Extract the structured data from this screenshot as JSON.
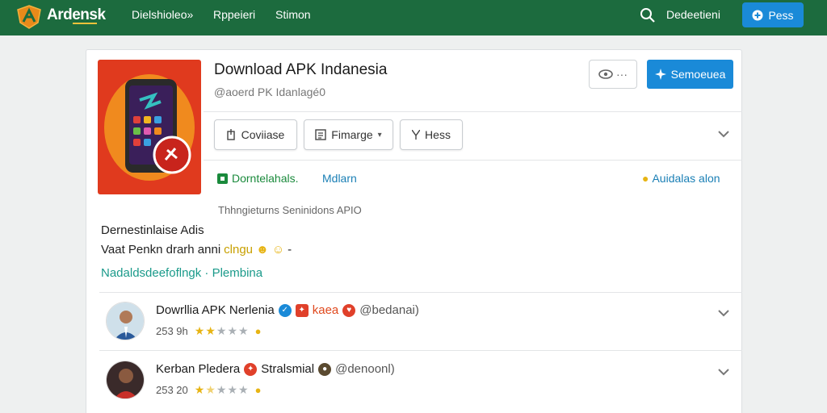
{
  "topbar": {
    "brand": "Ardensk",
    "nav": [
      "Dielshioleo»",
      "Rppeieri",
      "Stimon"
    ],
    "user_label": "Dedeetieni",
    "action_button": "Pess",
    "icons": {
      "logo": "shield-logo-icon",
      "search": "search-icon",
      "action": "plus-icon"
    }
  },
  "app": {
    "title": "Download APK Indanesia",
    "subtitle": "@aoerd PK Idanlagé0",
    "eye_button": "···",
    "primary_button": "Semoeuea",
    "pills": [
      {
        "label": "Coviiase",
        "icon": "download-icon"
      },
      {
        "label": "Fimarge",
        "icon": "list-icon"
      },
      {
        "label": "Hess",
        "icon": "filter-icon"
      }
    ],
    "status": "Dorntelahals.",
    "status_link": "Mdlarn",
    "notice": "Auidalas alon"
  },
  "section": {
    "caption": "Thhngieturns Seninidons APIO",
    "heading": "Dernestinlaise Adis",
    "line": "Vaat Penkn drarh anni",
    "line_highlight": "clngu",
    "tags": "Nadaldsdeefoflngk · Plembina"
  },
  "reviews": [
    {
      "name": "Dowrllia APK Nerlenia",
      "tag": "kaea",
      "handle": "@bedanai)",
      "meta": "253 9h",
      "rating": 2.5
    },
    {
      "name": "Kerban Pledera",
      "tag": "Stralsmial",
      "handle": "@denoonl)",
      "meta": "253 20",
      "rating": 1.5
    }
  ],
  "colors": {
    "topbar": "#1c6b3e",
    "primary": "#1a8ad8",
    "status_green": "#1a8a3c",
    "link_blue": "#1a7fb5",
    "app_icon_bg": "#e03a1e"
  }
}
